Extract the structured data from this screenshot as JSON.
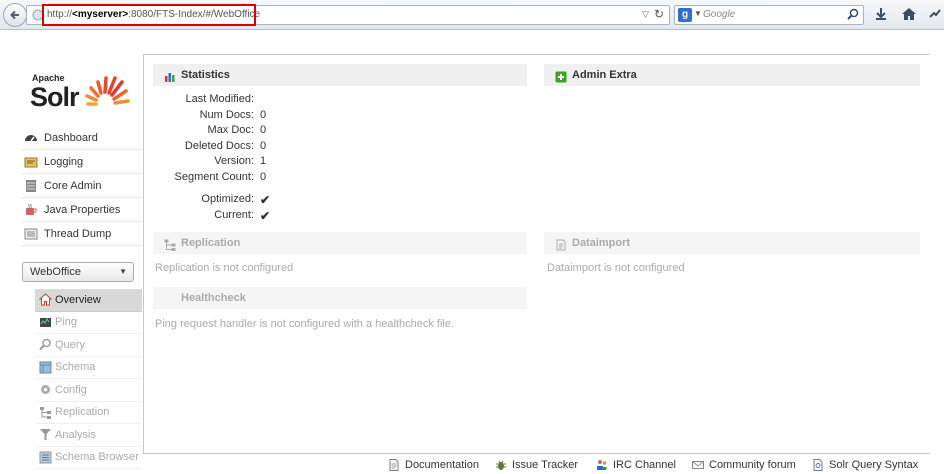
{
  "browser": {
    "url_prefix": "http://",
    "url_host": "<myserver>",
    "url_rest": ":8080/FTS-Index/#/WebOffice",
    "search_placeholder": "Google"
  },
  "logo": {
    "apache": "Apache",
    "solr": "Solr"
  },
  "nav": {
    "items": [
      {
        "label": "Dashboard",
        "icon": "dashboard-icon"
      },
      {
        "label": "Logging",
        "icon": "logging-icon"
      },
      {
        "label": "Core Admin",
        "icon": "core-admin-icon"
      },
      {
        "label": "Java Properties",
        "icon": "java-properties-icon"
      },
      {
        "label": "Thread Dump",
        "icon": "thread-dump-icon"
      }
    ]
  },
  "core_selector": {
    "value": "WebOffice"
  },
  "core_nav": {
    "items": [
      {
        "label": "Overview",
        "active": true
      },
      {
        "label": "Ping"
      },
      {
        "label": "Query"
      },
      {
        "label": "Schema"
      },
      {
        "label": "Config"
      },
      {
        "label": "Replication"
      },
      {
        "label": "Analysis"
      },
      {
        "label": "Schema Browser"
      }
    ]
  },
  "statistics": {
    "title": "Statistics",
    "rows": [
      {
        "label": "Last Modified:",
        "value": ""
      },
      {
        "label": "Num Docs:",
        "value": "0"
      },
      {
        "label": "Max Doc:",
        "value": "0"
      },
      {
        "label": "Deleted Docs:",
        "value": "0"
      },
      {
        "label": "Version:",
        "value": "1"
      },
      {
        "label": "Segment Count:",
        "value": "0"
      }
    ],
    "flags": [
      {
        "label": "Optimized:",
        "value": "✔"
      },
      {
        "label": "Current:",
        "value": "✔"
      }
    ]
  },
  "admin_extra": {
    "title": "Admin Extra"
  },
  "replication": {
    "title": "Replication",
    "message": "Replication is not configured"
  },
  "dataimport": {
    "title": "Dataimport",
    "message": "Dataimport is not configured"
  },
  "healthcheck": {
    "title": "Healthcheck",
    "message": "Ping request handler is not configured with a healthcheck file."
  },
  "footer": {
    "links": [
      {
        "label": "Documentation"
      },
      {
        "label": "Issue Tracker"
      },
      {
        "label": "IRC Channel"
      },
      {
        "label": "Community forum"
      },
      {
        "label": "Solr Query Syntax"
      }
    ]
  },
  "colors": {
    "accent_green": "#3aa620",
    "highlight_red": "#e00000",
    "active_nav": "#d8d8d8"
  }
}
